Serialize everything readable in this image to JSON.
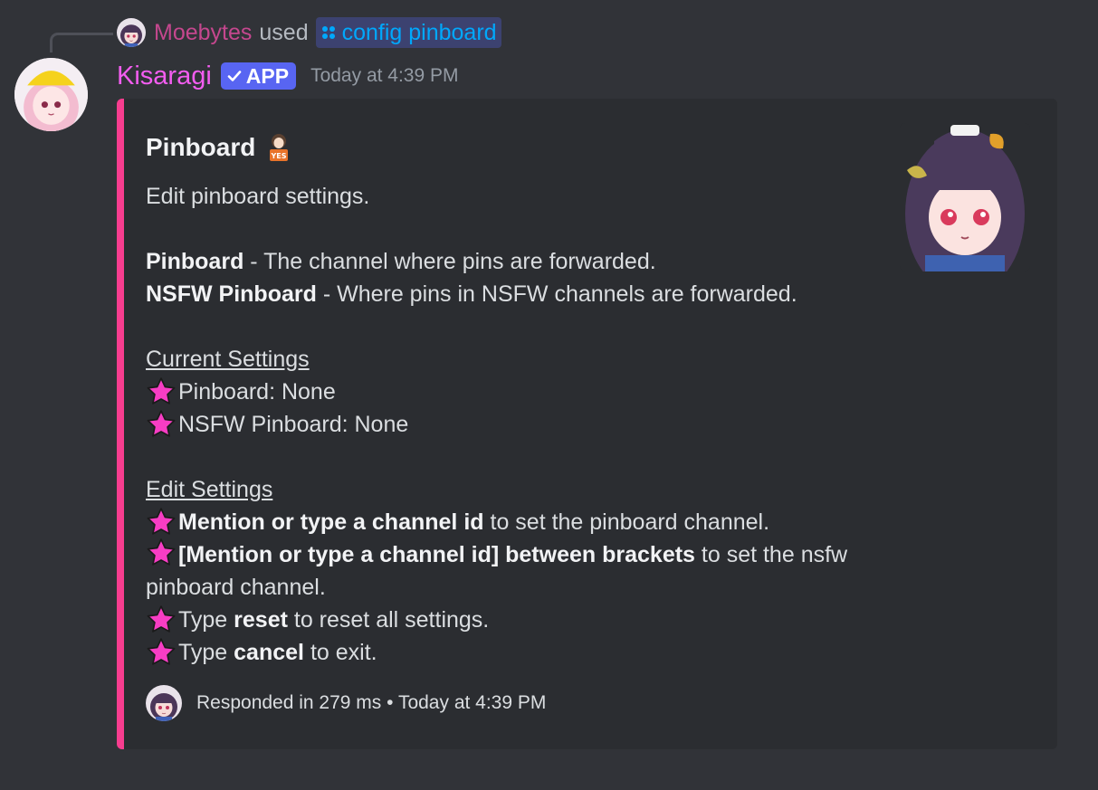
{
  "interaction": {
    "invoker_name": "Moebytes",
    "used_word": "used",
    "command": "config pinboard",
    "command_icon": "slash-command-icon"
  },
  "author": {
    "name": "Kisaragi",
    "badge": "APP",
    "timestamp": "Today at 4:39 PM",
    "name_color": "#f35df0"
  },
  "embed": {
    "accent_color": "#f73d8f",
    "title": "Pinboard",
    "title_emoji": "yes-sign-emoji",
    "description": "Edit pinboard settings.",
    "fields": {
      "pinboard_label": "Pinboard",
      "pinboard_desc": " - The channel where pins are forwarded.",
      "nsfw_label": "NSFW Pinboard",
      "nsfw_desc": " - Where pins in NSFW channels are forwarded."
    },
    "current_settings": {
      "heading": "Current Settings",
      "items": [
        "Pinboard: None",
        "NSFW Pinboard: None"
      ]
    },
    "edit_settings": {
      "heading": "Edit Settings",
      "item1_bold": "Mention or type a channel id",
      "item1_rest": " to set the pinboard channel.",
      "item2_bold": "[Mention or type a channel id] between brackets",
      "item2_rest": " to set the nsfw pinboard channel.",
      "item3_pre": "Type ",
      "item3_bold": "reset",
      "item3_rest": " to reset all settings.",
      "item4_pre": "Type ",
      "item4_bold": "cancel",
      "item4_rest": " to exit."
    },
    "footer": "Responded in 279 ms • Today at 4:39 PM"
  },
  "colors": {
    "background": "#313338",
    "embed_background": "#2b2d31",
    "invoker": "#c5478e",
    "command": "#00a8fc",
    "badge": "#5865f2",
    "star": "#f73dc4"
  }
}
